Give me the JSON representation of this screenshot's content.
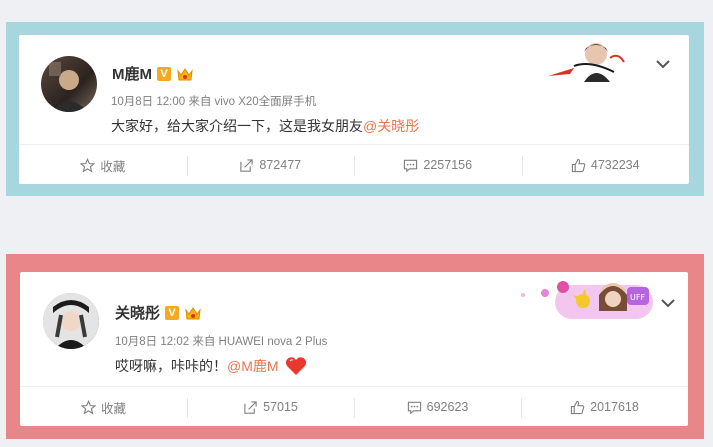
{
  "posts": [
    {
      "username": "M鹿M",
      "v_badge": "V",
      "meta": "10月8日 12:00 来自 vivo X20全面屏手机",
      "text": "大家好，给大家介绍一下，这是我女朋友",
      "mention": "@关晓彤",
      "actions": {
        "favorite_label": "收藏",
        "repost_count": "872477",
        "comment_count": "2257156",
        "like_count": "4732234"
      },
      "frame_color": "#a8d6df"
    },
    {
      "username": "关晓彤",
      "v_badge": "V",
      "meta": "10月8日 12:02 来自 HUAWEI nova 2 Plus",
      "text": "哎呀嘛，咔咔的！",
      "mention": "@M鹿M",
      "actions": {
        "favorite_label": "收藏",
        "repost_count": "57015",
        "comment_count": "692623",
        "like_count": "2017618"
      },
      "frame_color": "#e8868a"
    }
  ],
  "colors": {
    "mention": "#eb7350",
    "v_badge": "#f6a821",
    "text": "#333333",
    "meta": "#808080"
  }
}
